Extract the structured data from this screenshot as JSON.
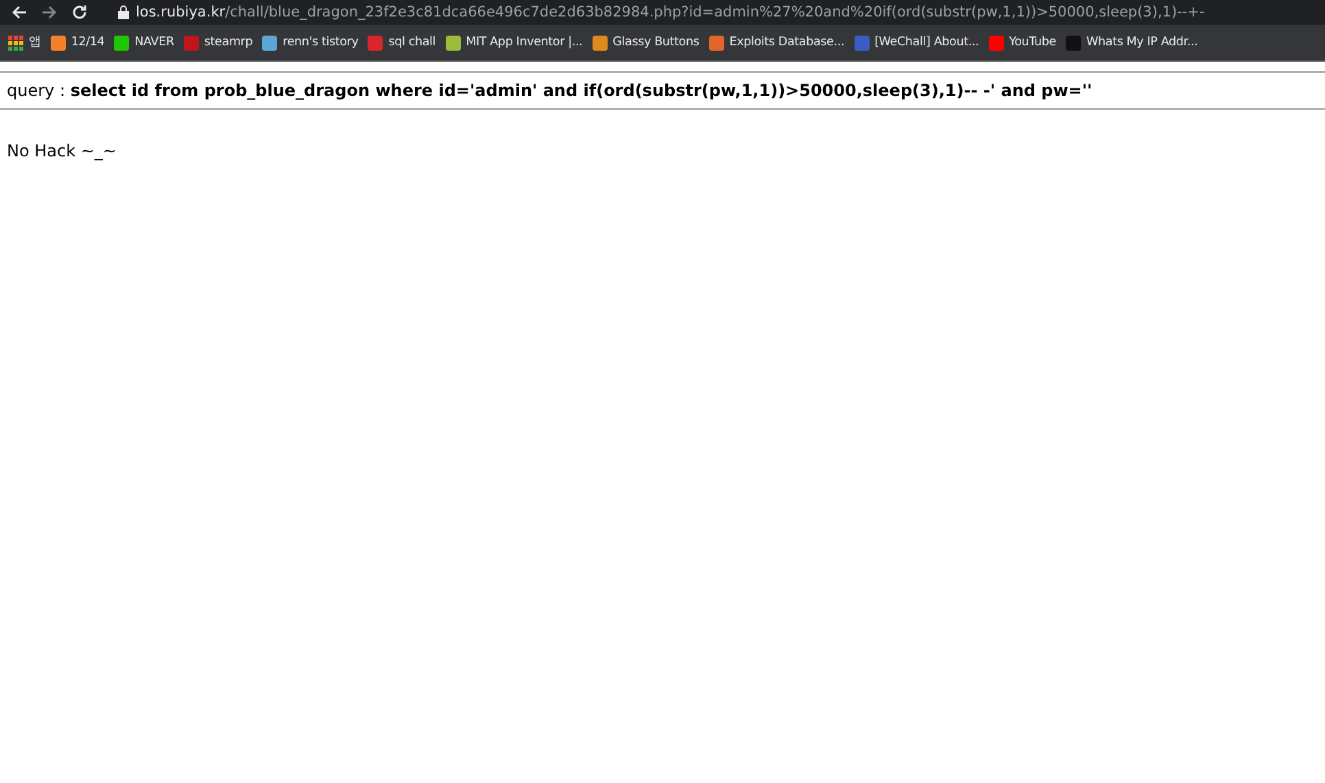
{
  "browser": {
    "url_host": "los.rubiya.kr",
    "url_path": "/chall/blue_dragon_23f2e3c81dca66e496c7de2d63b82984.php?id=admin%27%20and%20if(ord(substr(pw,1,1))>50000,sleep(3),1)--+-",
    "apps_label": "앱",
    "bookmarks": [
      {
        "label": "12/14",
        "color": "#f4812a"
      },
      {
        "label": "NAVER",
        "color": "#1ec800"
      },
      {
        "label": "steamrp",
        "color": "#c0161b"
      },
      {
        "label": "renn's tistory",
        "color": "#5aa7d6"
      },
      {
        "label": "sql chall",
        "color": "#d9262b"
      },
      {
        "label": "MIT App Inventor |...",
        "color": "#9bbb3a"
      },
      {
        "label": "Glassy Buttons",
        "color": "#e08a1e"
      },
      {
        "label": "Exploits Database...",
        "color": "#e0662a"
      },
      {
        "label": "[WeChall] About...",
        "color": "#3c5cc4"
      },
      {
        "label": "YouTube",
        "color": "#ff0000"
      },
      {
        "label": "Whats My IP Addr...",
        "color": "#111111"
      }
    ]
  },
  "page": {
    "query": "query : **select id from prob_blue_dragon where id='admin' and if(ord(substr(pw,1,1))>50000,sleep(3),1)-- -' and pw=''**",
    "message": "No Hack ~_~"
  }
}
